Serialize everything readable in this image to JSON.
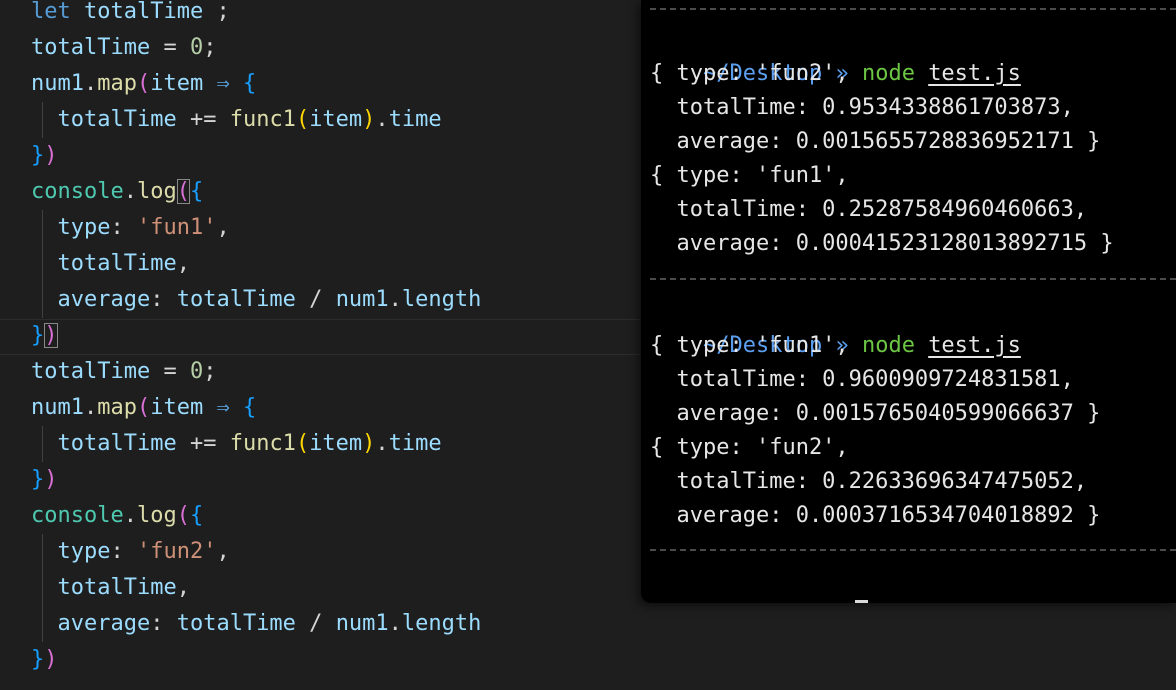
{
  "editor": {
    "lines": [
      {
        "tokens": [
          [
            "kw",
            "let"
          ],
          [
            "op",
            " "
          ],
          [
            "var",
            "totalTime"
          ],
          [
            "op",
            " ;"
          ]
        ]
      },
      {
        "tokens": [
          [
            "var",
            "totalTime"
          ],
          [
            "op",
            " = "
          ],
          [
            "num",
            "0"
          ],
          [
            "op",
            ";"
          ]
        ]
      },
      {
        "tokens": [
          [
            "var",
            "num1"
          ],
          [
            "op",
            "."
          ],
          [
            "fn",
            "map"
          ],
          [
            "br2",
            "("
          ],
          [
            "var",
            "item"
          ],
          [
            "op",
            " "
          ],
          [
            "kw",
            "⇒"
          ],
          [
            "op",
            " "
          ],
          [
            "br3",
            "{"
          ]
        ]
      },
      {
        "tokens": [
          [
            "op",
            "  "
          ],
          [
            "var",
            "totalTime"
          ],
          [
            "op",
            " += "
          ],
          [
            "fn",
            "func1"
          ],
          [
            "br1",
            "("
          ],
          [
            "var",
            "item"
          ],
          [
            "br1",
            ")"
          ],
          [
            "op",
            "."
          ],
          [
            "var",
            "time"
          ]
        ]
      },
      {
        "tokens": [
          [
            "br3",
            "}"
          ],
          [
            "br2",
            ")"
          ]
        ]
      },
      {
        "tokens": [
          [
            "obj",
            "console"
          ],
          [
            "op",
            "."
          ],
          [
            "fn",
            "log"
          ],
          [
            "br2 match",
            "("
          ],
          [
            "br3",
            "{"
          ]
        ]
      },
      {
        "tokens": [
          [
            "op",
            "  "
          ],
          [
            "var",
            "type"
          ],
          [
            "op",
            ": "
          ],
          [
            "str",
            "'fun1'"
          ],
          [
            "op",
            ","
          ]
        ]
      },
      {
        "tokens": [
          [
            "op",
            "  "
          ],
          [
            "var",
            "totalTime"
          ],
          [
            "op",
            ","
          ]
        ]
      },
      {
        "tokens": [
          [
            "op",
            "  "
          ],
          [
            "var",
            "average"
          ],
          [
            "op",
            ": "
          ],
          [
            "var",
            "totalTime"
          ],
          [
            "op",
            " / "
          ],
          [
            "var",
            "num1"
          ],
          [
            "op",
            "."
          ],
          [
            "var",
            "length"
          ]
        ]
      },
      {
        "tokens": [
          [
            "br3",
            "}"
          ],
          [
            "br2 match",
            ")"
          ]
        ]
      },
      {
        "tokens": [
          [
            "var",
            "totalTime"
          ],
          [
            "op",
            " = "
          ],
          [
            "num",
            "0"
          ],
          [
            "op",
            ";"
          ]
        ]
      },
      {
        "tokens": [
          [
            "var",
            "num1"
          ],
          [
            "op",
            "."
          ],
          [
            "fn",
            "map"
          ],
          [
            "br2",
            "("
          ],
          [
            "var",
            "item"
          ],
          [
            "op",
            " "
          ],
          [
            "kw",
            "⇒"
          ],
          [
            "op",
            " "
          ],
          [
            "br3",
            "{"
          ]
        ]
      },
      {
        "tokens": [
          [
            "op",
            "  "
          ],
          [
            "var",
            "totalTime"
          ],
          [
            "op",
            " += "
          ],
          [
            "fn",
            "func1"
          ],
          [
            "br1",
            "("
          ],
          [
            "var",
            "item"
          ],
          [
            "br1",
            ")"
          ],
          [
            "op",
            "."
          ],
          [
            "var",
            "time"
          ]
        ]
      },
      {
        "tokens": [
          [
            "br3",
            "}"
          ],
          [
            "br2",
            ")"
          ]
        ]
      },
      {
        "tokens": [
          [
            "obj",
            "console"
          ],
          [
            "op",
            "."
          ],
          [
            "fn",
            "log"
          ],
          [
            "br2",
            "("
          ],
          [
            "br3",
            "{"
          ]
        ]
      },
      {
        "tokens": [
          [
            "op",
            "  "
          ],
          [
            "var",
            "type"
          ],
          [
            "op",
            ": "
          ],
          [
            "str",
            "'fun2'"
          ],
          [
            "op",
            ","
          ]
        ]
      },
      {
        "tokens": [
          [
            "op",
            "  "
          ],
          [
            "var",
            "totalTime"
          ],
          [
            "op",
            ","
          ]
        ]
      },
      {
        "tokens": [
          [
            "op",
            "  "
          ],
          [
            "var",
            "average"
          ],
          [
            "op",
            ": "
          ],
          [
            "var",
            "totalTime"
          ],
          [
            "op",
            " / "
          ],
          [
            "var",
            "num1"
          ],
          [
            "op",
            "."
          ],
          [
            "var",
            "length"
          ]
        ]
      },
      {
        "tokens": [
          [
            "br3",
            "}"
          ],
          [
            "br2",
            ")"
          ]
        ]
      }
    ]
  },
  "terminal": {
    "prompt_path": "~/Desktop",
    "prompt_arrow": "»",
    "runs": [
      {
        "command": "node",
        "file": "test.js",
        "output": [
          "{ type: 'fun2',",
          "  totalTime: 0.9534338861703873,",
          "  average: 0.0015655728836952171 }",
          "{ type: 'fun1',",
          "  totalTime: 0.25287584960460663,",
          "  average: 0.00041523128013892715 }"
        ]
      },
      {
        "command": "node",
        "file": "test.js",
        "output": [
          "{ type: 'fun1',",
          "  totalTime: 0.9600909724831581,",
          "  average: 0.0015765040599066637 }",
          "{ type: 'fun2',",
          "  totalTime: 0.22633696347475052,",
          "  average: 0.0003716534704018892 }"
        ]
      }
    ],
    "colors": {
      "path": "#5c9ff0",
      "command": "#6cc644",
      "output": "#e6e6e6",
      "background": "#000000"
    }
  }
}
